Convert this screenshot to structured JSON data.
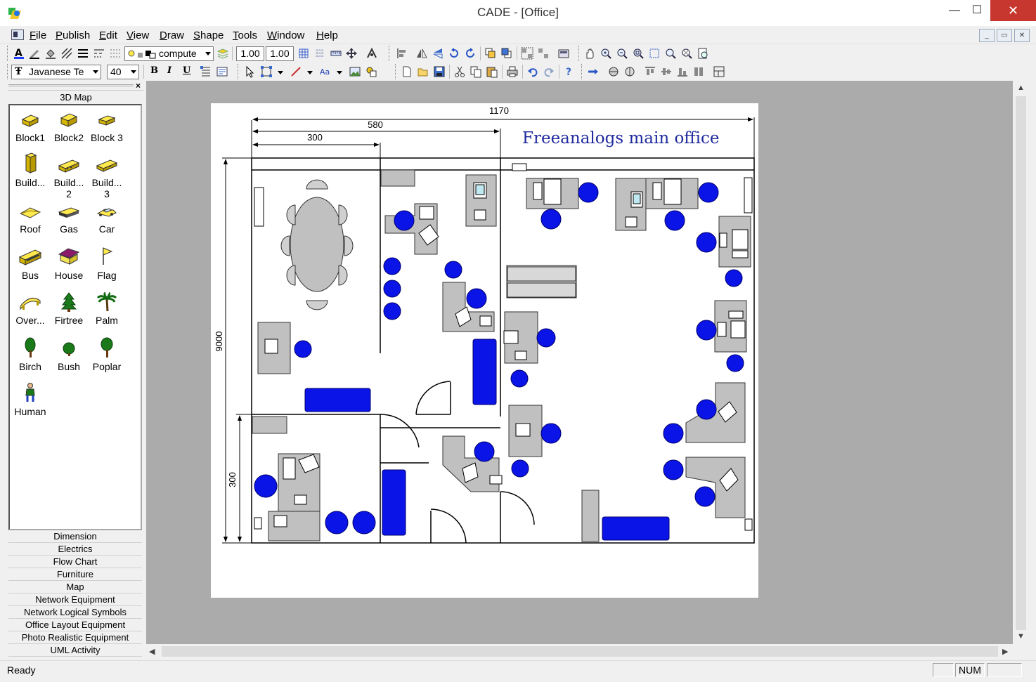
{
  "window": {
    "title": "CADE - [Office]",
    "minimize_glyph": "—",
    "maximize_glyph": "☐",
    "close_glyph": "✕"
  },
  "menu": {
    "items": [
      "File",
      "Publish",
      "Edit",
      "View",
      "Draw",
      "Shape",
      "Tools",
      "Window",
      "Help"
    ],
    "mdi_minimize": "_",
    "mdi_restore": "▭",
    "mdi_close": "✕"
  },
  "toolbar": {
    "layer_combo": "compute",
    "line_width": "1.00",
    "line_scale": "1.00",
    "font_name": "Javanese Te",
    "font_size": "40",
    "bold_label": "B",
    "italic_label": "I",
    "underline_label": "U",
    "icons": [
      "text-color-icon",
      "line-color-icon",
      "fill-color-icon",
      "pattern-icon",
      "line-weight-icon",
      "line-style-icon",
      "layer-icon",
      "grid-icon",
      "snap-icon",
      "align-icon",
      "flip-icon",
      "rotate-icon",
      "group-icon",
      "zoom-icon",
      "pan-icon",
      "select-icon",
      "connector-icon",
      "new-icon",
      "open-icon",
      "save-icon",
      "cut-icon",
      "copy-icon",
      "paste-icon",
      "print-icon",
      "undo-icon",
      "redo-icon",
      "help-icon"
    ]
  },
  "left_panel": {
    "header": "3D Map",
    "close_glyph": "×",
    "shapes": [
      {
        "label": "Block1",
        "icon": "block-icon"
      },
      {
        "label": "Block2",
        "icon": "block-icon"
      },
      {
        "label": "Block 3",
        "icon": "block-icon"
      },
      {
        "label": "Build...",
        "icon": "building-icon"
      },
      {
        "label": "Build...\n2",
        "icon": "building-icon"
      },
      {
        "label": "Build...\n3",
        "icon": "building-icon"
      },
      {
        "label": "Roof",
        "icon": "roof-icon"
      },
      {
        "label": "Gas",
        "icon": "gas-station-icon"
      },
      {
        "label": "Car",
        "icon": "car-icon"
      },
      {
        "label": "Bus",
        "icon": "bus-icon"
      },
      {
        "label": "House",
        "icon": "house-icon"
      },
      {
        "label": "Flag",
        "icon": "flag-icon"
      },
      {
        "label": "Over...",
        "icon": "overpass-icon"
      },
      {
        "label": "Firtree",
        "icon": "firtree-icon"
      },
      {
        "label": "Palm",
        "icon": "palm-icon"
      },
      {
        "label": "Birch",
        "icon": "birch-icon"
      },
      {
        "label": "Bush",
        "icon": "bush-icon"
      },
      {
        "label": "Poplar",
        "icon": "poplar-icon"
      },
      {
        "label": "Human",
        "icon": "human-icon"
      }
    ],
    "categories": [
      "Dimension",
      "Electrics",
      "Flow Chart",
      "Furniture",
      "Map",
      "Network Equipment",
      "Network Logical Symbols",
      "Office Layout Equipment",
      "Photo Realistic Equipment",
      "UML Activity"
    ]
  },
  "drawing": {
    "title": "Freeanalogs main office",
    "dimensions": {
      "total_width": "1170",
      "width_580": "580",
      "width_300": "300",
      "total_height": "9000",
      "height_300": "300"
    },
    "colors": {
      "chair": "#0a14e6",
      "furniture": "#c0c0c0",
      "wall": "#000000"
    }
  },
  "scroll": {
    "up": "▲",
    "down": "▼",
    "left": "◀",
    "right": "▶"
  },
  "status": {
    "text": "Ready",
    "num": "NUM"
  }
}
